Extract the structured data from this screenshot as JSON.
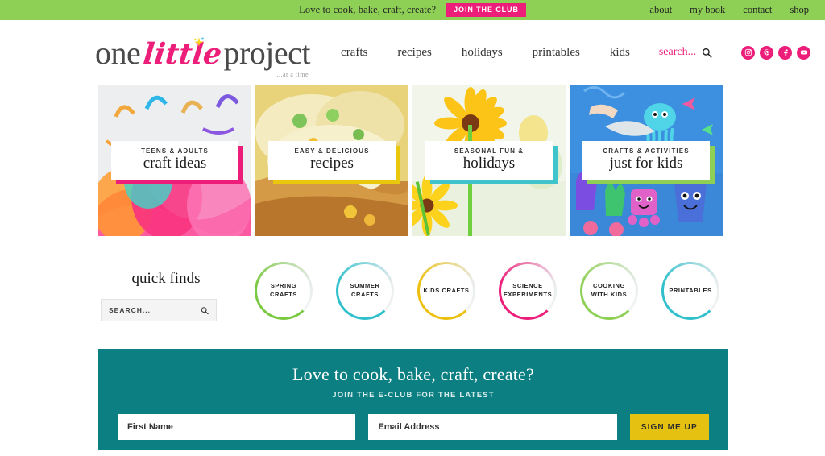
{
  "topbar": {
    "tagline": "Love to cook, bake, craft, create?",
    "join_label": "JOIN THE CLUB",
    "links": [
      {
        "label": "about"
      },
      {
        "label": "my book"
      },
      {
        "label": "contact"
      },
      {
        "label": "shop"
      }
    ],
    "bg_color": "#8ed055",
    "join_color": "#ec1e79"
  },
  "header": {
    "logo": {
      "part1": "one",
      "part2": "little",
      "part3": "project",
      "tagline": "...at a time",
      "accent_color": "#ec1e79"
    },
    "nav": [
      {
        "label": "crafts"
      },
      {
        "label": "recipes"
      },
      {
        "label": "holidays"
      },
      {
        "label": "printables"
      },
      {
        "label": "kids"
      }
    ],
    "search": {
      "label": "search...",
      "icon": "search-icon"
    },
    "socials": [
      {
        "name": "instagram-icon"
      },
      {
        "name": "pinterest-icon"
      },
      {
        "name": "facebook-icon"
      },
      {
        "name": "youtube-icon"
      }
    ]
  },
  "cards": [
    {
      "kicker": "TEENS & ADULTS",
      "title": "craft ideas",
      "accent": "#ec1e79"
    },
    {
      "kicker": "EASY & DELICIOUS",
      "title": "recipes",
      "accent": "#e9c70c"
    },
    {
      "kicker": "SEASONAL FUN &",
      "title": "holidays",
      "accent": "#3fc4cc"
    },
    {
      "kicker": "CRAFTS & ACTIVITIES",
      "title": "just for kids",
      "accent": "#8ed055"
    }
  ],
  "quick_finds": {
    "heading": "quick finds",
    "search_placeholder": "SEARCH...",
    "circles": [
      {
        "label": "SPRING\nCRAFTS",
        "color": "#7ac943"
      },
      {
        "label": "SUMMER\nCRAFTS",
        "color": "#2fc0cc"
      },
      {
        "label": "KIDS CRAFTS",
        "color": "#edc010"
      },
      {
        "label": "SCIENCE\nEXPERIMENTS",
        "color": "#ec1e79"
      },
      {
        "label": "COOKING\nWITH KIDS",
        "color": "#8ed055"
      },
      {
        "label": "PRINTABLES",
        "color": "#2fc0cc"
      }
    ]
  },
  "eclub": {
    "title": "Love to cook, bake, craft, create?",
    "subtitle": "JOIN THE E-CLUB FOR THE LATEST",
    "firstname_placeholder": "First Name",
    "email_placeholder": "Email Address",
    "button_label": "SIGN ME UP",
    "bg_color": "#0b7f81",
    "button_color": "#e5c111"
  }
}
